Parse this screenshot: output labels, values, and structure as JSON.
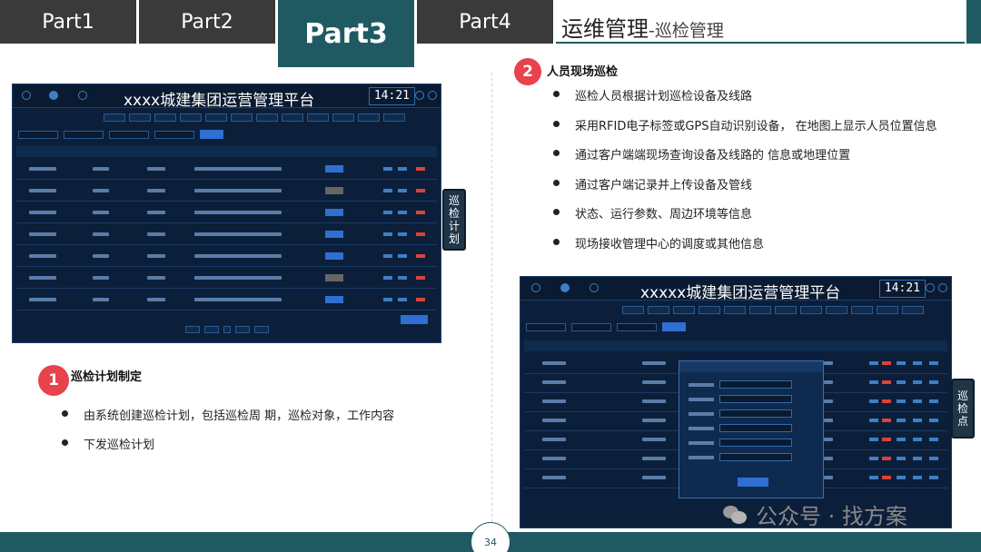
{
  "tabs": [
    {
      "label": "Part1"
    },
    {
      "label": "Part2"
    },
    {
      "label": "Part3"
    },
    {
      "label": "Part4"
    }
  ],
  "section_title": {
    "main": "运维管理",
    "sub": "-巡检管理"
  },
  "screenshot_1": {
    "title": "xxxx城建集团运营管理平台",
    "time": "14:21"
  },
  "screenshot_2": {
    "title": "xxxxx城建集团运营管理平台",
    "time": "14:21"
  },
  "side_tags": {
    "tag1": [
      "巡",
      "检",
      "计",
      "划"
    ],
    "tag2": [
      "巡",
      "检",
      "点"
    ]
  },
  "section1": {
    "number": "1",
    "heading": "巡检计划制定",
    "bullets": [
      "由系统创建巡检计划，包括巡检周 期，巡检对象，工作内容",
      "下发巡检计划"
    ]
  },
  "section2": {
    "number": "2",
    "heading": "人员现场巡检",
    "bullets": [
      "巡检人员根据计划巡检设备及线路",
      "采用RFID电子标签或GPS自动识别设备， 在地图上显示人员位置信息",
      "通过客户端端现场查询设备及线路的 信息或地理位置",
      "通过客户端记录并上传设备及管线",
      "状态、运行参数、周边环境等信息",
      "现场接收管理中心的调度或其他信息"
    ]
  },
  "page_number": "34",
  "watermark": "公众号 · 找方案",
  "colors": {
    "accent": "#1f5a63",
    "badge_red": "#e8424c",
    "dark_tab": "#3a3a3a",
    "screen_bg": "#0c1f3a",
    "ui_blue": "#2f6fd2"
  }
}
